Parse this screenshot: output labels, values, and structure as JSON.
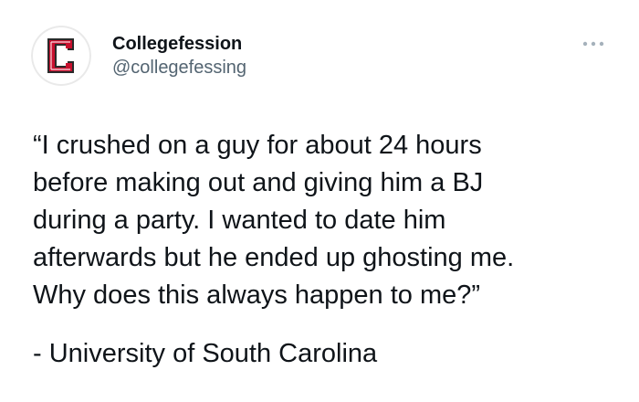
{
  "author": {
    "display_name": "Collegefession",
    "handle": "@collegefessing",
    "avatar_letter": "C",
    "avatar_icon": "college-c-logo-icon",
    "brand_color": "#c8102e"
  },
  "menu": {
    "icon": "more-horizontal-icon",
    "icon_color": "#a5b1bb"
  },
  "tweet": {
    "lines": [
      "“I crushed on a guy for about 24 hours",
      "before making out and giving him a BJ",
      "during a party. I wanted to date him",
      "afterwards but he ended up ghosting me.",
      "Why does this always happen to me?”"
    ],
    "signature": "- University of South Carolina"
  }
}
